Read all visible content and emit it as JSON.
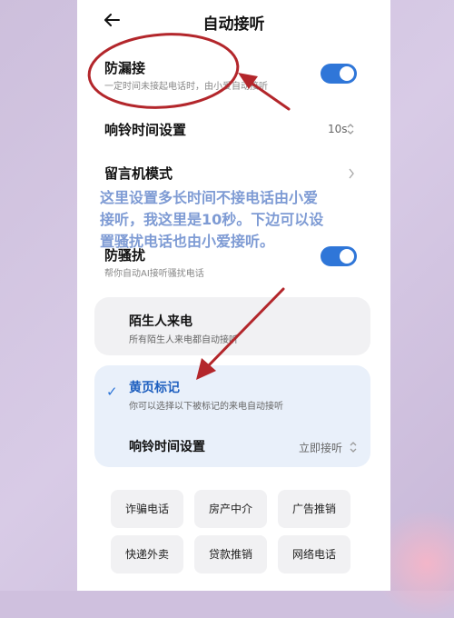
{
  "header": {
    "title": "自动接听"
  },
  "missed_calls": {
    "title": "防漏接",
    "subtitle": "一定时间未接起电话时，由小爱自动接听"
  },
  "ring_time": {
    "label": "响铃时间设置",
    "value": "10s"
  },
  "answering_machine": {
    "label": "留言机模式"
  },
  "anti_harass": {
    "title": "防骚扰",
    "subtitle": "帮你自动AI接听骚扰电话"
  },
  "stranger": {
    "title": "陌生人来电",
    "subtitle": "所有陌生人来电都自动接听"
  },
  "yellow_pages": {
    "title": "黄页标记",
    "subtitle": "你可以选择以下被标记的来电自动接听",
    "ring_label": "响铃时间设置",
    "ring_value": "立即接听"
  },
  "categories": [
    "诈骗电话",
    "房产中介",
    "广告推销",
    "快递外卖",
    "贷款推销",
    "网络电话"
  ],
  "annotation": {
    "line1": "这里设置多长时间不接电话由小爱",
    "line2": "接听，我这里是10秒。下边可以设",
    "line3": "置骚扰电话也由小爱接听。"
  },
  "colors": {
    "accent": "#2f76d8",
    "annotation_red": "#b3262b",
    "annotation_text": "#5a7fc8"
  }
}
